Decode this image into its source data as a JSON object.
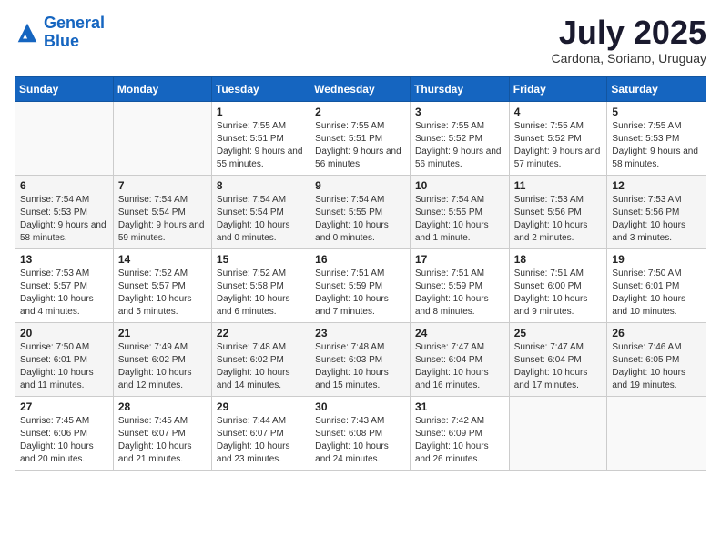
{
  "logo": {
    "line1": "General",
    "line2": "Blue"
  },
  "title": "July 2025",
  "subtitle": "Cardona, Soriano, Uruguay",
  "weekdays": [
    "Sunday",
    "Monday",
    "Tuesday",
    "Wednesday",
    "Thursday",
    "Friday",
    "Saturday"
  ],
  "weeks": [
    [
      {
        "day": "",
        "info": ""
      },
      {
        "day": "",
        "info": ""
      },
      {
        "day": "1",
        "info": "Sunrise: 7:55 AM\nSunset: 5:51 PM\nDaylight: 9 hours and 55 minutes."
      },
      {
        "day": "2",
        "info": "Sunrise: 7:55 AM\nSunset: 5:51 PM\nDaylight: 9 hours and 56 minutes."
      },
      {
        "day": "3",
        "info": "Sunrise: 7:55 AM\nSunset: 5:52 PM\nDaylight: 9 hours and 56 minutes."
      },
      {
        "day": "4",
        "info": "Sunrise: 7:55 AM\nSunset: 5:52 PM\nDaylight: 9 hours and 57 minutes."
      },
      {
        "day": "5",
        "info": "Sunrise: 7:55 AM\nSunset: 5:53 PM\nDaylight: 9 hours and 58 minutes."
      }
    ],
    [
      {
        "day": "6",
        "info": "Sunrise: 7:54 AM\nSunset: 5:53 PM\nDaylight: 9 hours and 58 minutes."
      },
      {
        "day": "7",
        "info": "Sunrise: 7:54 AM\nSunset: 5:54 PM\nDaylight: 9 hours and 59 minutes."
      },
      {
        "day": "8",
        "info": "Sunrise: 7:54 AM\nSunset: 5:54 PM\nDaylight: 10 hours and 0 minutes."
      },
      {
        "day": "9",
        "info": "Sunrise: 7:54 AM\nSunset: 5:55 PM\nDaylight: 10 hours and 0 minutes."
      },
      {
        "day": "10",
        "info": "Sunrise: 7:54 AM\nSunset: 5:55 PM\nDaylight: 10 hours and 1 minute."
      },
      {
        "day": "11",
        "info": "Sunrise: 7:53 AM\nSunset: 5:56 PM\nDaylight: 10 hours and 2 minutes."
      },
      {
        "day": "12",
        "info": "Sunrise: 7:53 AM\nSunset: 5:56 PM\nDaylight: 10 hours and 3 minutes."
      }
    ],
    [
      {
        "day": "13",
        "info": "Sunrise: 7:53 AM\nSunset: 5:57 PM\nDaylight: 10 hours and 4 minutes."
      },
      {
        "day": "14",
        "info": "Sunrise: 7:52 AM\nSunset: 5:57 PM\nDaylight: 10 hours and 5 minutes."
      },
      {
        "day": "15",
        "info": "Sunrise: 7:52 AM\nSunset: 5:58 PM\nDaylight: 10 hours and 6 minutes."
      },
      {
        "day": "16",
        "info": "Sunrise: 7:51 AM\nSunset: 5:59 PM\nDaylight: 10 hours and 7 minutes."
      },
      {
        "day": "17",
        "info": "Sunrise: 7:51 AM\nSunset: 5:59 PM\nDaylight: 10 hours and 8 minutes."
      },
      {
        "day": "18",
        "info": "Sunrise: 7:51 AM\nSunset: 6:00 PM\nDaylight: 10 hours and 9 minutes."
      },
      {
        "day": "19",
        "info": "Sunrise: 7:50 AM\nSunset: 6:01 PM\nDaylight: 10 hours and 10 minutes."
      }
    ],
    [
      {
        "day": "20",
        "info": "Sunrise: 7:50 AM\nSunset: 6:01 PM\nDaylight: 10 hours and 11 minutes."
      },
      {
        "day": "21",
        "info": "Sunrise: 7:49 AM\nSunset: 6:02 PM\nDaylight: 10 hours and 12 minutes."
      },
      {
        "day": "22",
        "info": "Sunrise: 7:48 AM\nSunset: 6:02 PM\nDaylight: 10 hours and 14 minutes."
      },
      {
        "day": "23",
        "info": "Sunrise: 7:48 AM\nSunset: 6:03 PM\nDaylight: 10 hours and 15 minutes."
      },
      {
        "day": "24",
        "info": "Sunrise: 7:47 AM\nSunset: 6:04 PM\nDaylight: 10 hours and 16 minutes."
      },
      {
        "day": "25",
        "info": "Sunrise: 7:47 AM\nSunset: 6:04 PM\nDaylight: 10 hours and 17 minutes."
      },
      {
        "day": "26",
        "info": "Sunrise: 7:46 AM\nSunset: 6:05 PM\nDaylight: 10 hours and 19 minutes."
      }
    ],
    [
      {
        "day": "27",
        "info": "Sunrise: 7:45 AM\nSunset: 6:06 PM\nDaylight: 10 hours and 20 minutes."
      },
      {
        "day": "28",
        "info": "Sunrise: 7:45 AM\nSunset: 6:07 PM\nDaylight: 10 hours and 21 minutes."
      },
      {
        "day": "29",
        "info": "Sunrise: 7:44 AM\nSunset: 6:07 PM\nDaylight: 10 hours and 23 minutes."
      },
      {
        "day": "30",
        "info": "Sunrise: 7:43 AM\nSunset: 6:08 PM\nDaylight: 10 hours and 24 minutes."
      },
      {
        "day": "31",
        "info": "Sunrise: 7:42 AM\nSunset: 6:09 PM\nDaylight: 10 hours and 26 minutes."
      },
      {
        "day": "",
        "info": ""
      },
      {
        "day": "",
        "info": ""
      }
    ]
  ]
}
